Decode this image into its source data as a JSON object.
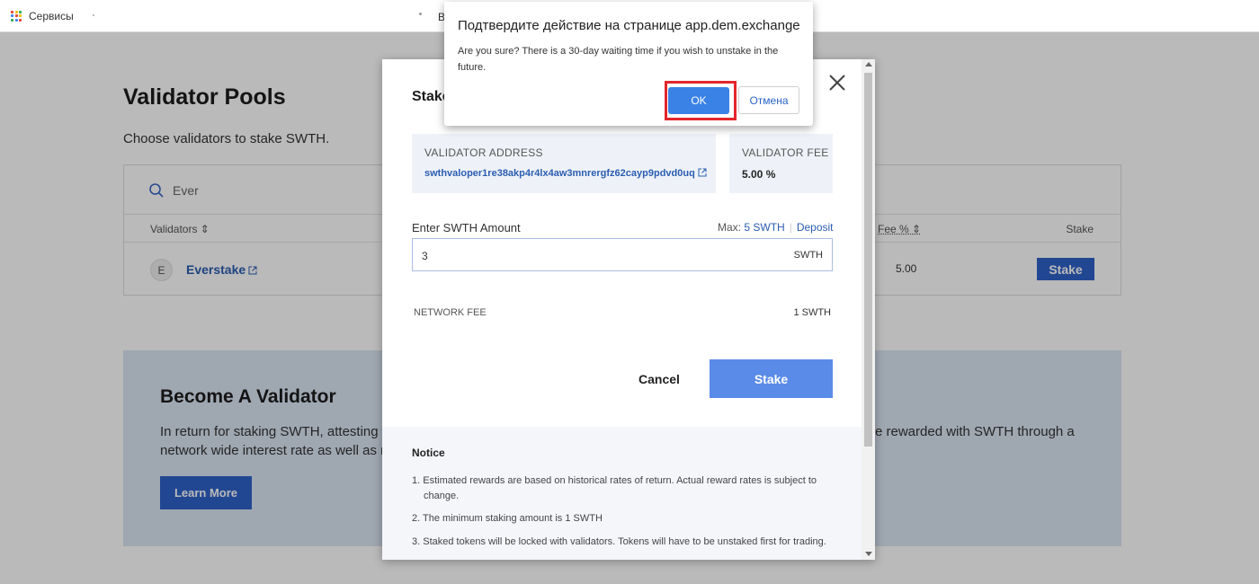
{
  "browser": {
    "bookmark_label": "Сервисы",
    "partial_bookmark": "В"
  },
  "page": {
    "title": "Validator Pools",
    "subtitle": "Choose validators to stake SWTH.",
    "search_value": "Ever",
    "columns": {
      "validators": "Validators ⇕",
      "fee": "Fee % ⇕",
      "stake": "Stake"
    },
    "row": {
      "avatar": "E",
      "name": "Everstake",
      "fee": "5.00",
      "stake_button": "Stake"
    },
    "become": {
      "title": "Become A Validator",
      "text_left": "In return for staking SWTH, attesting to",
      "text_left2": "network wide interest rate as well as re",
      "text_right": "e rewarded with SWTH through a",
      "button": "Learn More"
    }
  },
  "modal": {
    "title": "Stake",
    "validator_address_label": "VALIDATOR ADDRESS",
    "validator_address": "swthvaloper1re38akp4r4lx4aw3mnrergfz62cayp9pdvd0uq",
    "validator_fee_label": "VALIDATOR FEE",
    "validator_fee": "5.00 %",
    "amount_label": "Enter SWTH Amount",
    "max_label": "Max:",
    "max_value": "5 SWTH",
    "deposit_link": "Deposit",
    "amount_value": "3",
    "amount_unit": "SWTH",
    "network_fee_label": "NETWORK FEE",
    "network_fee": "1 SWTH",
    "cancel_button": "Cancel",
    "stake_button": "Stake",
    "notice_title": "Notice",
    "notice_items": [
      "1. Estimated rewards are based on historical rates of return. Actual reward rates is subject to change.",
      "2. The minimum staking amount is 1 SWTH",
      "3. Staked tokens will be locked with validators. Tokens will have to be unstaked first for trading."
    ]
  },
  "confirm": {
    "title": "Подтвердите действие на странице app.dem.exchange",
    "message": "Are you sure? There is a 30-day waiting time if you wish to unstake in the future.",
    "ok": "OK",
    "cancel": "Отмена"
  },
  "colors": {
    "accent": "#2f62c8",
    "highlight": "#e3262b",
    "apps_icon": [
      "#ea4335",
      "#fbbc05",
      "#34a853",
      "#4285f4",
      "#ea4335",
      "#fbbc05",
      "#34a853",
      "#4285f4",
      "#ea4335"
    ]
  }
}
